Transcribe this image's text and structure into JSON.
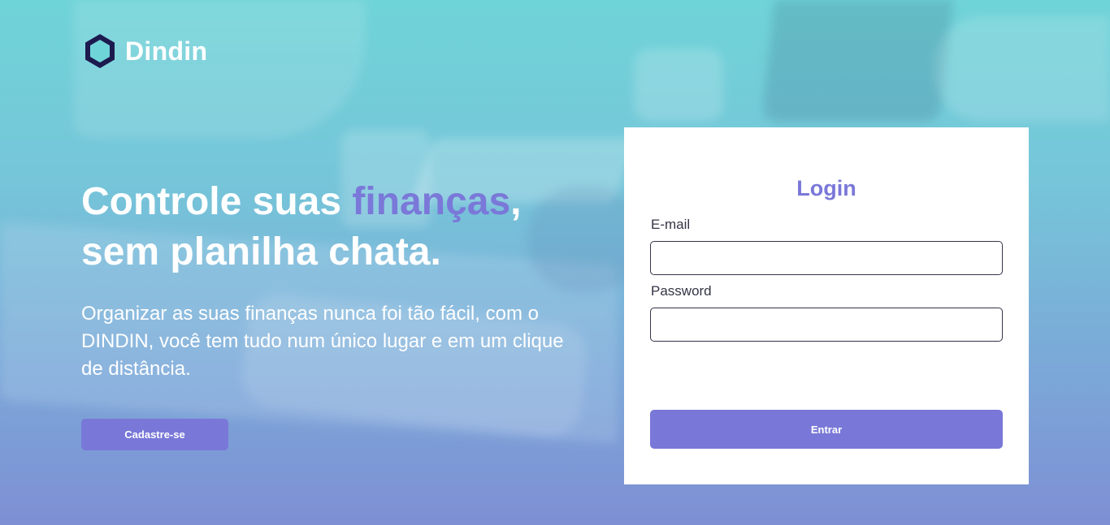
{
  "brand": {
    "name": "Dindin",
    "icon": "hexagon-logo-icon"
  },
  "hero": {
    "headline_part1": "Controle suas ",
    "headline_accent": "finanças",
    "headline_part2": ",",
    "headline_line2": "sem planilha chata.",
    "subtitle": "Organizar as suas finanças nunca foi tão fácil, com o DINDIN, você tem tudo num único lugar e em um clique de distância.",
    "signup_label": "Cadastre-se"
  },
  "login": {
    "title": "Login",
    "email_label": "E-mail",
    "email_value": "",
    "password_label": "Password",
    "password_value": "",
    "submit_label": "Entrar"
  },
  "colors": {
    "accent": "#7a78d8",
    "button": "#7978d8",
    "text_dark": "#343447",
    "logo_dark": "#1c1a4e",
    "logo_light": "#6fd4d8"
  }
}
